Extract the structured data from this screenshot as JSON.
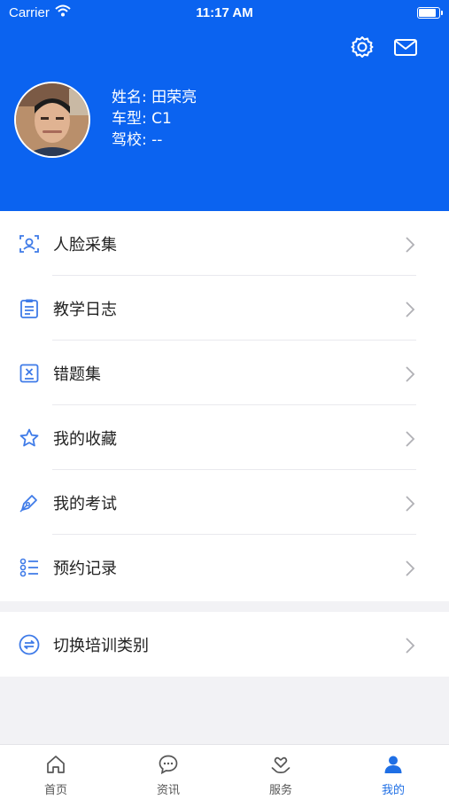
{
  "status_bar": {
    "carrier": "Carrier",
    "time": "11:17 AM"
  },
  "header": {
    "name_label": "姓名:",
    "name": "田荣亮",
    "car_type_label": "车型:",
    "car_type": "C1",
    "school_label": "驾校:",
    "school": "--"
  },
  "menu": {
    "items": [
      {
        "label": "人脸采集",
        "icon": "face-scan-icon"
      },
      {
        "label": "教学日志",
        "icon": "clipboard-icon"
      },
      {
        "label": "错题集",
        "icon": "wrong-questions-icon"
      },
      {
        "label": "我的收藏",
        "icon": "star-icon"
      },
      {
        "label": "我的考试",
        "icon": "pen-icon"
      },
      {
        "label": "预约记录",
        "icon": "list-icon"
      }
    ],
    "switch_label": "切换培训类别"
  },
  "tabbar": {
    "tabs": [
      {
        "label": "首页",
        "icon": "home-icon"
      },
      {
        "label": "资讯",
        "icon": "chat-icon"
      },
      {
        "label": "服务",
        "icon": "heart-hand-icon"
      },
      {
        "label": "我的",
        "icon": "user-icon"
      }
    ],
    "active": "我的"
  },
  "colors": {
    "primary": "#0b63f0",
    "active_tab": "#1f6fe5",
    "icon_blue": "#3f7be8"
  }
}
